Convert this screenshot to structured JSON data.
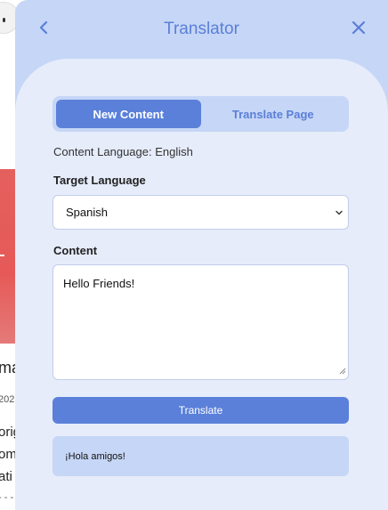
{
  "background_page": {
    "fragments": [
      "mar",
      "202",
      "orig",
      "om",
      "ati",
      "- - -"
    ]
  },
  "header": {
    "title": "Translator",
    "back_icon": "chevron-left-icon",
    "close_icon": "close-icon"
  },
  "tabs": [
    {
      "label": "New Content",
      "active": true
    },
    {
      "label": "Translate Page",
      "active": false
    }
  ],
  "content_language_text": "Content Language: English",
  "target_language": {
    "label": "Target Language",
    "selected": "Spanish"
  },
  "content": {
    "label": "Content",
    "value": "Hello Friends!"
  },
  "translate_button_label": "Translate",
  "result_text": "¡Hola amigos!",
  "colors": {
    "accent": "#5a80da",
    "panel_bg": "#c6d6f6",
    "card_bg": "#e6ecfa",
    "title_color": "#5a7fd8"
  }
}
